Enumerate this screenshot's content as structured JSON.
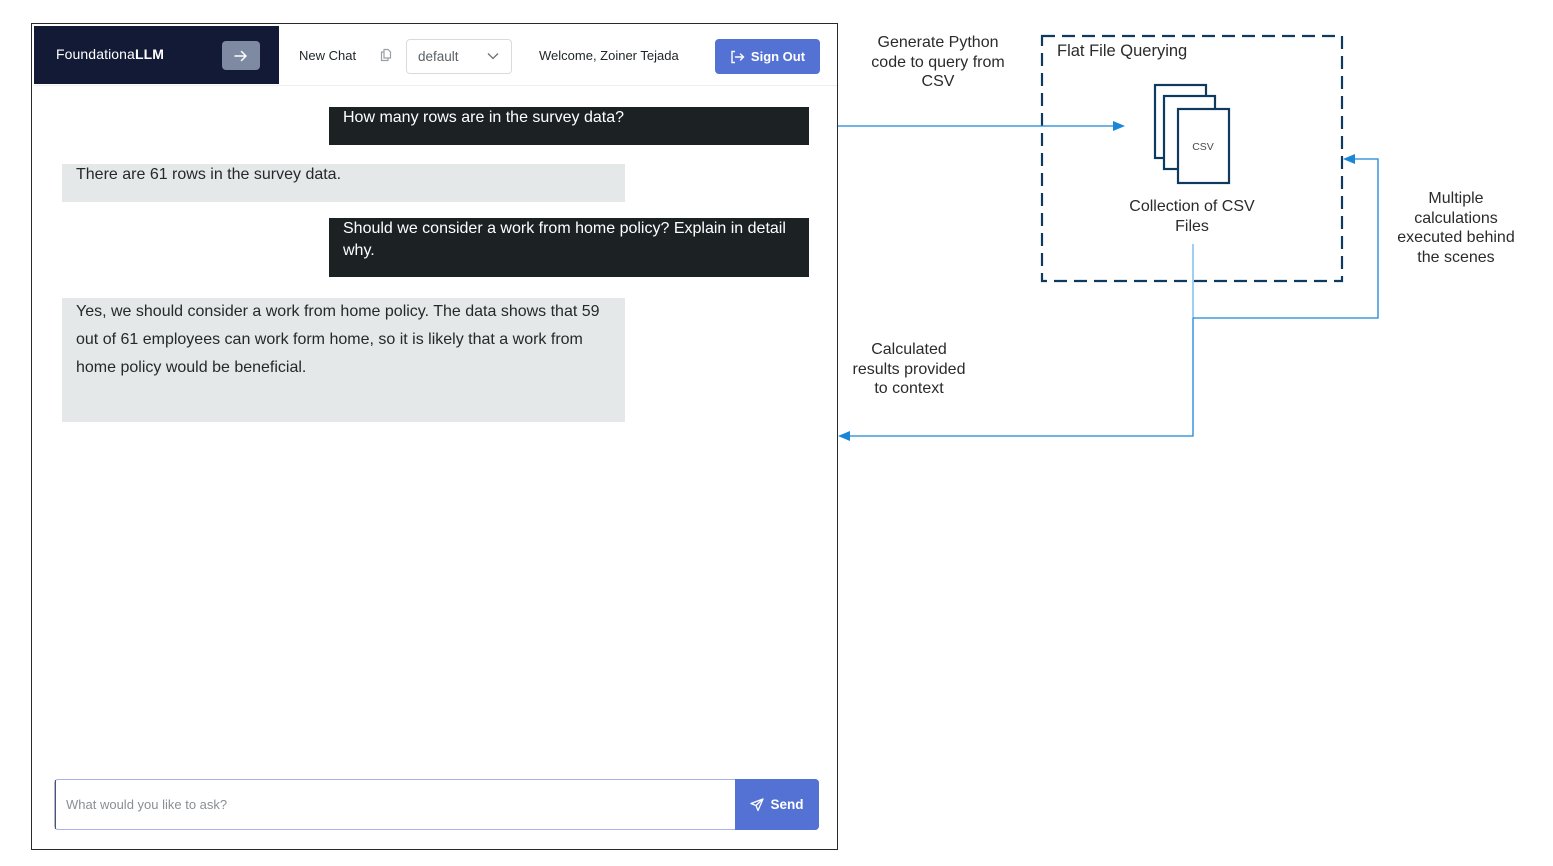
{
  "app": {
    "brand": {
      "prefix": "Foundationa",
      "suffix": "LLM"
    },
    "header": {
      "collapse_icon": "arrow-right-icon",
      "new_chat_label": "New Chat",
      "copy_icon": "copy-icon",
      "session_select": {
        "value": "default"
      },
      "welcome_text": "Welcome, Zoiner Tejada",
      "sign_out_label": "Sign Out",
      "sign_out_icon": "sign-out-icon"
    },
    "messages": [
      {
        "role": "user",
        "text": "How many rows are in the survey data?"
      },
      {
        "role": "assistant",
        "text": "There are 61 rows in the survey data."
      },
      {
        "role": "user",
        "text": "Should we consider a work from home policy? Explain in detail why."
      },
      {
        "role": "assistant",
        "text": "Yes, we should consider a work from home policy. The data shows that 59 out of 61 employees can work form home, so it is likely that a work from home policy would be beneficial."
      }
    ],
    "composer": {
      "placeholder": "What would you like to ask?",
      "value": "",
      "send_label": "Send",
      "send_icon": "send-icon"
    },
    "colors": {
      "brand_bg": "#131a36",
      "primary": "#5472d3",
      "user_bubble": "#1c2124",
      "assistant_bubble": "#e5e8e9"
    }
  },
  "diagram": {
    "box_title": "Flat File Querying",
    "file_icon_label": "CSV",
    "file_collection_label": "Collection of CSV Files",
    "arrows": {
      "to_box": "Generate Python code to query from CSV",
      "loop": "Multiple calculations executed behind the scenes",
      "back_to_chat": "Calculated results provided to context"
    },
    "colors": {
      "box_border": "#0f3a5f",
      "arrow": "#1a86d8"
    }
  }
}
